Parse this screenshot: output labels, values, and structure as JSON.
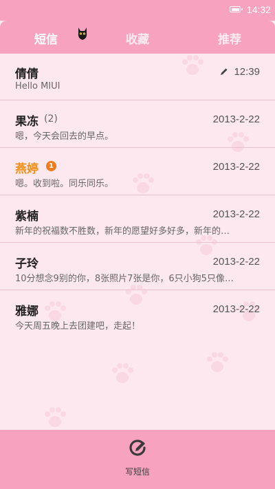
{
  "status_bar": {
    "time": "14:32",
    "battery_icon": "battery-full-icon"
  },
  "tabs": [
    {
      "label": "短信",
      "active": true
    },
    {
      "label": "收藏",
      "active": false
    },
    {
      "label": "推荐",
      "active": false
    }
  ],
  "conversations": [
    {
      "name": "倩倩",
      "count": "",
      "unread_badge": "",
      "date": "12:39",
      "draft": true,
      "preview": "Hello MIUI"
    },
    {
      "name": "果冻",
      "count": "(2)",
      "unread_badge": "",
      "date": "2013-2-22",
      "draft": false,
      "preview": "嗯，今天会回去的早点。"
    },
    {
      "name": "燕婷",
      "count": "",
      "unread_badge": "1",
      "date": "2013-2-22",
      "draft": false,
      "preview": "嗯。收到啦。同乐同乐。"
    },
    {
      "name": "紫楠",
      "count": "",
      "unread_badge": "",
      "date": "2013-2-22",
      "draft": false,
      "preview": "新年的祝福数不胜数，新年的愿望好多好多，新年的…"
    },
    {
      "name": "子玲",
      "count": "",
      "unread_badge": "",
      "date": "2013-2-22",
      "draft": false,
      "preview": "10分想念9别的你，8张照片7张是你，6只小狗5只像…"
    },
    {
      "name": "雅娜",
      "count": "",
      "unread_badge": "",
      "date": "2013-2-22",
      "draft": false,
      "preview": "今天周五晚上去团建吧，走起！"
    }
  ],
  "bottom_bar": {
    "compose_label": "写短信",
    "compose_icon": "compose-icon"
  },
  "colors": {
    "accent_pink": "#f7a3bf",
    "background": "#fde8ef",
    "unread_name": "#f08f18",
    "unread_badge": "#f07b1a"
  }
}
